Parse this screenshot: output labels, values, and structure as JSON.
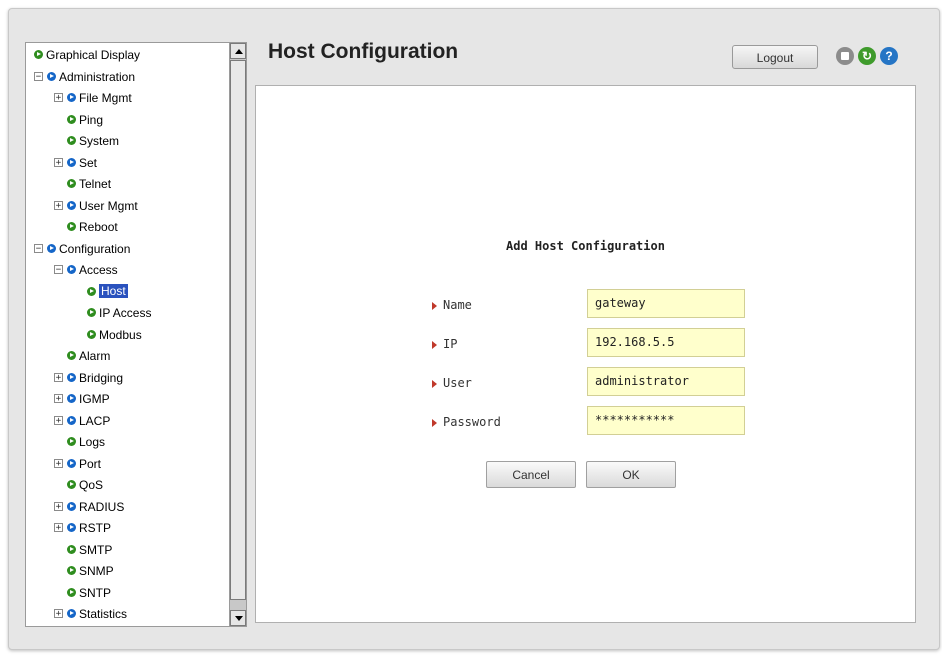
{
  "header": {
    "title": "Host Configuration",
    "logout_label": "Logout",
    "icons": [
      "save-icon",
      "refresh-icon",
      "help-icon"
    ],
    "colors": {
      "refresh": "#3f9b2c",
      "help": "#2575c5",
      "selected": "#2a52be",
      "input_bg": "#ffffcc"
    }
  },
  "tree": {
    "items": [
      {
        "label": "Graphical Display",
        "level": 0,
        "expander": "",
        "bullet": "green"
      },
      {
        "label": "Administration",
        "level": 0,
        "expander": "-",
        "bullet": "blue"
      },
      {
        "label": "File Mgmt",
        "level": 1,
        "expander": "+",
        "bullet": "blue"
      },
      {
        "label": "Ping",
        "level": 1,
        "expander": "",
        "bullet": "green"
      },
      {
        "label": "System",
        "level": 1,
        "expander": "",
        "bullet": "green"
      },
      {
        "label": "Set",
        "level": 1,
        "expander": "+",
        "bullet": "blue"
      },
      {
        "label": "Telnet",
        "level": 1,
        "expander": "",
        "bullet": "green"
      },
      {
        "label": "User Mgmt",
        "level": 1,
        "expander": "+",
        "bullet": "blue"
      },
      {
        "label": "Reboot",
        "level": 1,
        "expander": "",
        "bullet": "green"
      },
      {
        "label": "Configuration",
        "level": 0,
        "expander": "-",
        "bullet": "blue"
      },
      {
        "label": "Access",
        "level": 1,
        "expander": "-",
        "bullet": "blue"
      },
      {
        "label": "Host",
        "level": 2,
        "expander": "",
        "bullet": "green",
        "selected": true
      },
      {
        "label": "IP Access",
        "level": 2,
        "expander": "",
        "bullet": "green"
      },
      {
        "label": "Modbus",
        "level": 2,
        "expander": "",
        "bullet": "green"
      },
      {
        "label": "Alarm",
        "level": 1,
        "expander": "",
        "bullet": "green"
      },
      {
        "label": "Bridging",
        "level": 1,
        "expander": "+",
        "bullet": "blue"
      },
      {
        "label": "IGMP",
        "level": 1,
        "expander": "+",
        "bullet": "blue"
      },
      {
        "label": "LACP",
        "level": 1,
        "expander": "+",
        "bullet": "blue"
      },
      {
        "label": "Logs",
        "level": 1,
        "expander": "",
        "bullet": "green"
      },
      {
        "label": "Port",
        "level": 1,
        "expander": "+",
        "bullet": "blue"
      },
      {
        "label": "QoS",
        "level": 1,
        "expander": "",
        "bullet": "green"
      },
      {
        "label": "RADIUS",
        "level": 1,
        "expander": "+",
        "bullet": "blue"
      },
      {
        "label": "RSTP",
        "level": 1,
        "expander": "+",
        "bullet": "blue"
      },
      {
        "label": "SMTP",
        "level": 1,
        "expander": "",
        "bullet": "green"
      },
      {
        "label": "SNMP",
        "level": 1,
        "expander": "",
        "bullet": "green"
      },
      {
        "label": "SNTP",
        "level": 1,
        "expander": "",
        "bullet": "green"
      },
      {
        "label": "Statistics",
        "level": 1,
        "expander": "+",
        "bullet": "blue"
      }
    ]
  },
  "form": {
    "title": "Add Host Configuration",
    "fields": [
      {
        "label": "Name",
        "value": "gateway"
      },
      {
        "label": "IP",
        "value": "192.168.5.5"
      },
      {
        "label": "User",
        "value": "administrator"
      },
      {
        "label": "Password",
        "value": "***********"
      }
    ],
    "cancel_label": "Cancel",
    "ok_label": "OK"
  }
}
